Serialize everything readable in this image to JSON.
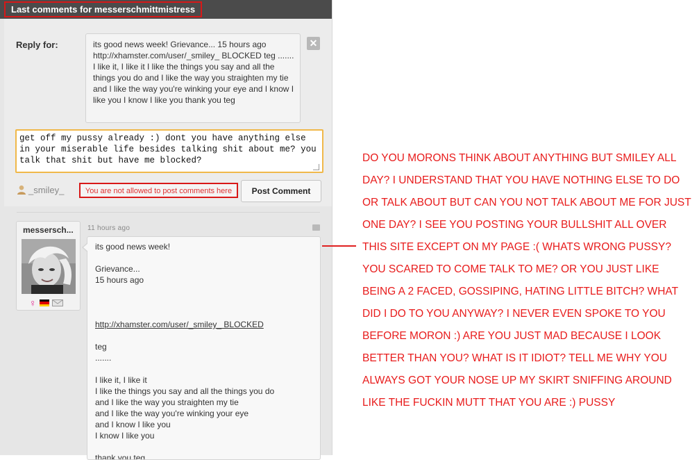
{
  "header": {
    "title": "Last comments for messerschmittmistress"
  },
  "reply": {
    "label": "Reply for:",
    "quote": "its good news week! Grievance... 15 hours ago http://xhamster.com/user/_smiley_ BLOCKED teg ....... I like it, I like it I like the things you say and all the things you do and I like the way you straighten my tie and I like the way you're winking your eye and I know I like you I know I like you thank you teg",
    "close_symbol": "✕"
  },
  "composer": {
    "text": "get off my pussy already :) dont you have anything else in your miserable life besides talking shit about me? you talk that shit but have me blocked?",
    "username": "_smiley_",
    "not_allowed": "You are not allowed to post comments here",
    "post_label": "Post Comment"
  },
  "comment": {
    "author": "messersch...",
    "time": "11 hours ago",
    "paragraphs": [
      "its good news week!",
      "Grievance...\n15 hours ago",
      "",
      "http://xhamster.com/user/_smiley_ BLOCKED",
      "teg\n.......",
      "I like it, I like it\nI like the things you say and all the things you do\nand I like the way you straighten my tie\nand I like the way you're winking your eye\nand I know I like you\nI know I like you",
      "thank you teg"
    ],
    "badges": [
      "female-icon",
      "germany-flag-icon",
      "mail-icon"
    ]
  },
  "annotation": {
    "text": "DO YOU MORONS THINK ABOUT ANYTHING BUT SMILEY ALL DAY? I UNDERSTAND THAT YOU HAVE NOTHING ELSE TO DO OR TALK ABOUT BUT CAN YOU NOT TALK ABOUT ME FOR JUST ONE DAY? I SEE YOU POSTING YOUR BULLSHIT ALL OVER THIS SITE EXCEPT ON MY PAGE :( WHATS WRONG PUSSY? YOU SCARED TO COME TALK TO ME? OR YOU JUST LIKE BEING A 2 FACED, GOSSIPING, HATING LITTLE BITCH? WHAT DID I DO TO YOU ANYWAY? I NEVER EVEN SPOKE TO YOU BEFORE MORON :)  ARE YOU JUST MAD BECAUSE I LOOK BETTER THAN YOU? WHAT IS IT IDIOT? TELL ME WHY YOU ALWAYS GOT YOUR NOSE UP MY SKIRT SNIFFING AROUND LIKE THE FUCKIN MUTT THAT YOU ARE :) PUSSY"
  },
  "colors": {
    "header_bg": "#4b4b4b",
    "highlight_red": "#d81818",
    "annotation_red": "#e81c1c",
    "input_focus": "#f0b849",
    "female_pink": "#e0208c"
  }
}
